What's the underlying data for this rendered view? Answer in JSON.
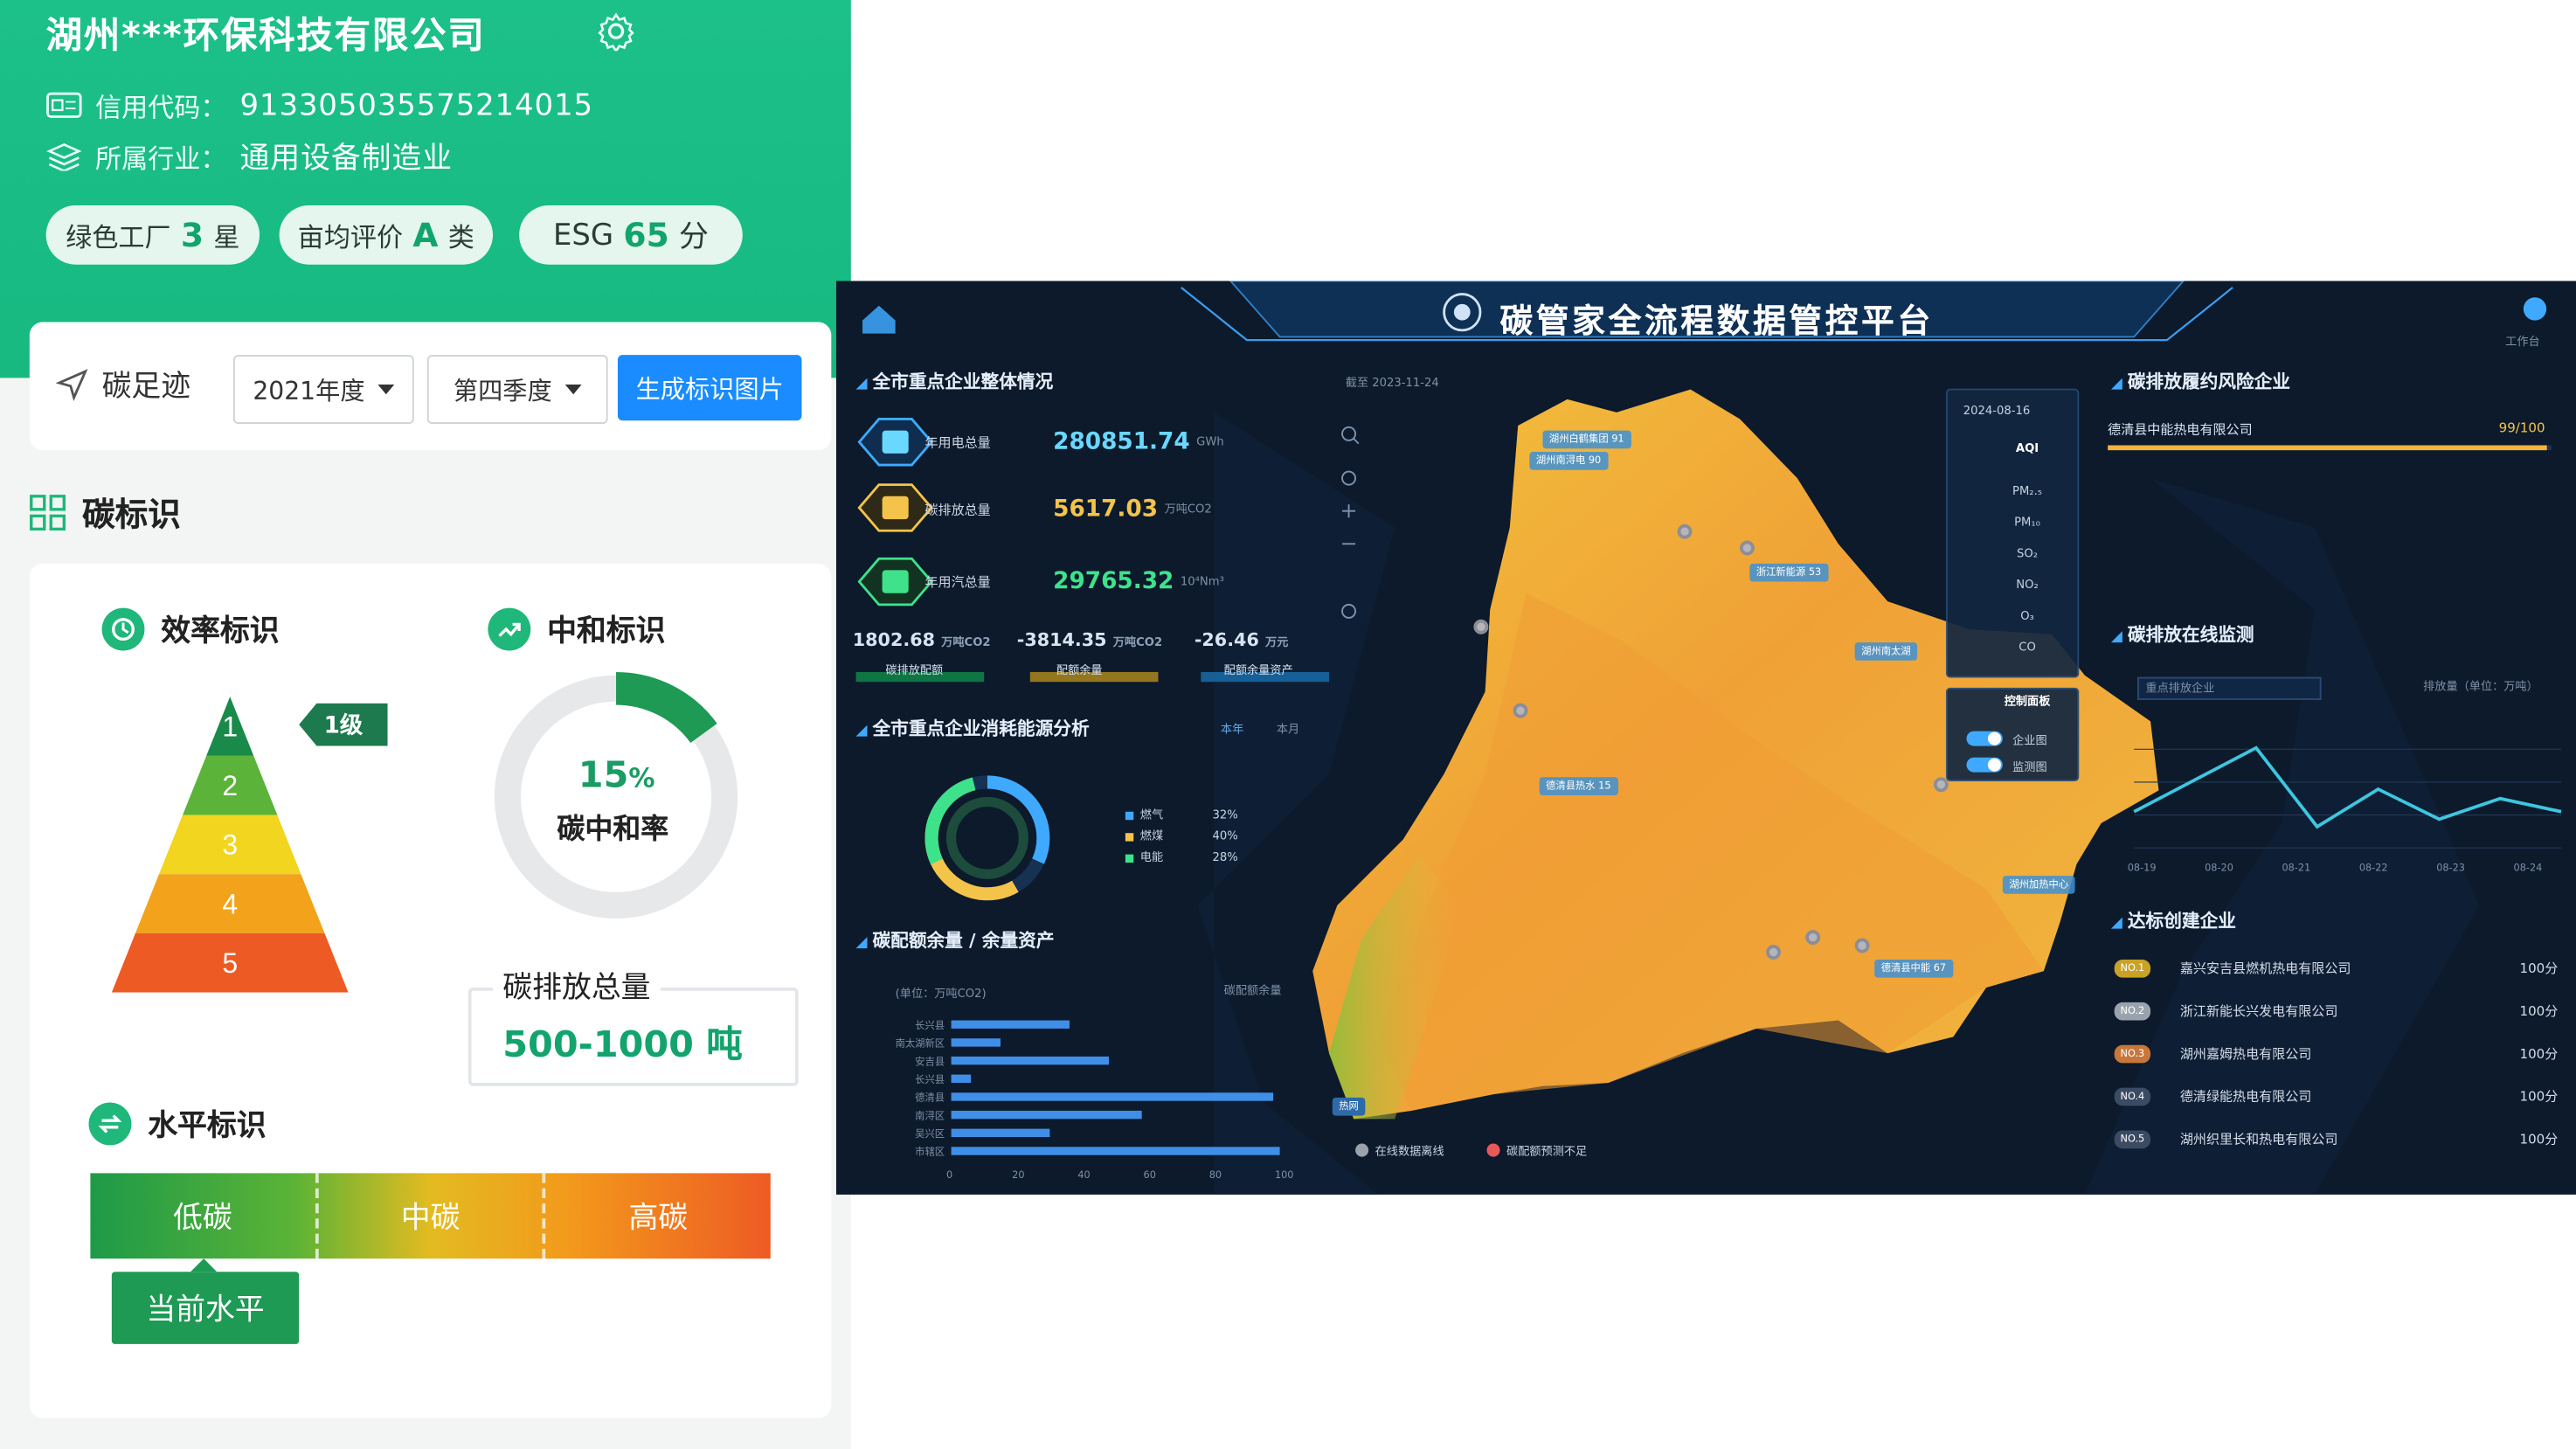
{
  "company": {
    "name": "湖州***环保科技有限公司",
    "credit_label": "信用代码：",
    "credit_code": "913305035575214015",
    "industry_label": "所属行业：",
    "industry": "通用设备制造业"
  },
  "tags": [
    {
      "prefix": "绿色工厂",
      "value": "3",
      "suffix": "星"
    },
    {
      "prefix": "亩均评价",
      "value": "A",
      "suffix": "类"
    },
    {
      "prefix": "ESG",
      "value": "65",
      "suffix": "分"
    }
  ],
  "footprint": {
    "label": "碳足迹",
    "year": "2021年度",
    "quarter": "第四季度",
    "generate_button": "生成标识图片"
  },
  "carbon_mark": {
    "title": "碳标识",
    "efficiency_title": "效率标识",
    "neutral_title": "中和标识",
    "level_tag": "1级",
    "pyramid_levels": [
      "1",
      "2",
      "3",
      "4",
      "5"
    ],
    "pyramid_colors": [
      "#1a8a4a",
      "#5bb33a",
      "#f2d51f",
      "#f2a31b",
      "#ee5a24"
    ],
    "neutral_rate_value": "15",
    "neutral_rate_unit": "%",
    "neutral_rate_fraction": 0.15,
    "neutral_rate_label": "碳中和率",
    "emission_label": "碳排放总量",
    "emission_value": "500-1000 吨",
    "level_title": "水平标识",
    "levels": [
      "低碳",
      "中碳",
      "高碳"
    ],
    "current_level": "当前水平"
  },
  "dashboard": {
    "title": "碳管家全流程数据管控平台",
    "workbench": "工作台",
    "overview_title": "全市重点企业整体情况",
    "kpis": [
      {
        "label": "年用电总量",
        "value": "280851.74",
        "unit": "GWh",
        "color": "#6ad7ff"
      },
      {
        "label": "碳排放总量",
        "value": "5617.03",
        "unit": "万吨CO2",
        "color": "#f4c34a"
      },
      {
        "label": "年用汽总量",
        "value": "29765.32",
        "unit": "10⁴Nm³",
        "color": "#3ee28b"
      }
    ],
    "sub_stats": [
      {
        "value": "1802.68",
        "unit": "万吨CO2",
        "label": "碳排放配额"
      },
      {
        "value": "-3814.35",
        "unit": "万吨CO2",
        "label": "配额余量"
      },
      {
        "value": "-26.46",
        "unit": "万元",
        "label": "配额余量资产"
      }
    ],
    "energy_title": "全市重点企业消耗能源分析",
    "energy_tabs": [
      "本年",
      "本月"
    ],
    "energy_legend": [
      {
        "name": "燃气",
        "pct": "32%",
        "color": "#3fa9ff"
      },
      {
        "name": "燃煤",
        "pct": "40%",
        "color": "#f4c34a"
      },
      {
        "name": "电能",
        "pct": "28%",
        "color": "#3ee28b"
      }
    ],
    "quota_title": "碳配额余量 / 余量资产",
    "quota_unit": "(单位：万吨CO2)",
    "quota_legend": "碳配额余量",
    "quota_categories": [
      "长兴县",
      "南太湖新区",
      "安吉县",
      "长兴县",
      "德清县",
      "南浔区",
      "吴兴区",
      "市辖区"
    ],
    "quota_values": [
      36,
      15,
      48,
      6,
      98,
      58,
      30,
      100
    ],
    "quota_axis": [
      "0",
      "20",
      "40",
      "60",
      "80",
      "100"
    ],
    "map_date": "截至 2023-11-24",
    "map_labels": [
      "湖州白鹤集团 91",
      "湖州南浔电 90",
      "浙江新能源 53",
      "湖州南太湖",
      "德清县热水 15",
      "德清县中能 67",
      "湖州加热中心"
    ],
    "map_legend": [
      "在线数据离线",
      "碳配额预测不足"
    ],
    "map_badge": "热网",
    "aqi_date": "2024-08-16",
    "aqi_label": "AQI",
    "aqi_items": [
      "PM₂.₅",
      "PM₁₀",
      "SO₂",
      "NO₂",
      "O₃",
      "CO"
    ],
    "control_title": "控制面板",
    "control_items": [
      "企业图",
      "监测图"
    ],
    "risk_title": "碳排放履约风险企业",
    "risk_company": "德清县中能热电有限公司",
    "risk_score": "99/100",
    "monitor_title": "碳排放在线监测",
    "monitor_select": "重点排放企业",
    "monitor_legend": "排放量（单位：万吨）",
    "monitor_dates": [
      "08-19",
      "08-20",
      "08-21",
      "08-22",
      "08-23",
      "08-24"
    ],
    "monitor_values": [
      28,
      45,
      62,
      20,
      40,
      24,
      35,
      28
    ],
    "standard_title": "达标创建企业",
    "standard_rows": [
      {
        "no": "NO.1",
        "name": "嘉兴安吉县燃机热电有限公司",
        "score": "100分",
        "color": "#c9a227"
      },
      {
        "no": "NO.2",
        "name": "浙江新能长兴发电有限公司",
        "score": "100分",
        "color": "#9aa3ad"
      },
      {
        "no": "NO.3",
        "name": "湖州嘉姆热电有限公司",
        "score": "100分",
        "color": "#c8773a"
      },
      {
        "no": "NO.4",
        "name": "德清绿能热电有限公司",
        "score": "100分",
        "color": "#3a4b63"
      },
      {
        "no": "NO.5",
        "name": "湖州织里长和热电有限公司",
        "score": "100分",
        "color": "#3a4b63"
      }
    ]
  }
}
